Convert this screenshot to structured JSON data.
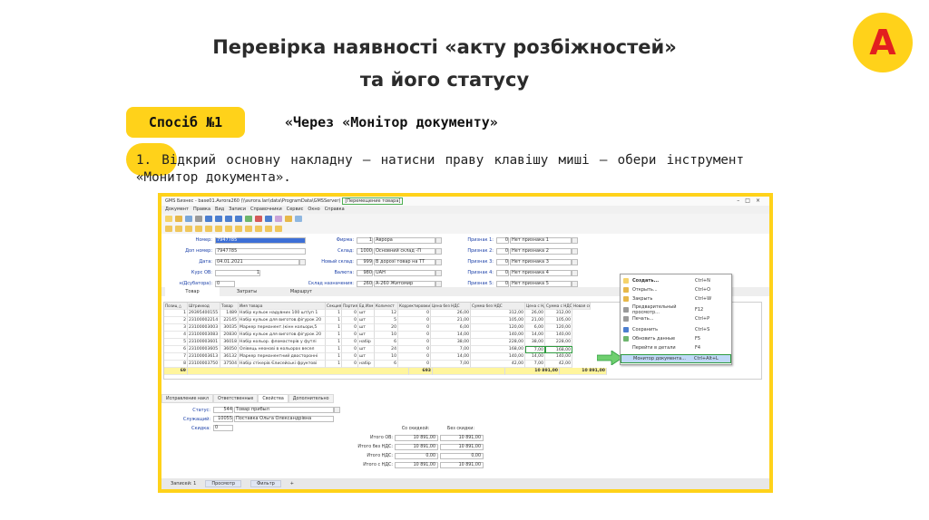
{
  "slide": {
    "title_line1": "Перевірка наявності «акту розбіжностей»",
    "title_line2": "та його статусу",
    "logo_letter": "А",
    "method_label": "Спосіб №1",
    "method_text": "«Через «Монітор документу»",
    "step_text": "1.  Відкрий основну накладну – натисни праву клавішу миші – обери інструмент «Монитор документа».",
    "colors": {
      "accent_yellow": "#ffd21a",
      "logo_red": "#e21f1f",
      "highlight_green": "#2e9b3f",
      "selection_blue": "#3d6fd6"
    }
  },
  "app": {
    "title": "GMS Бизнес - base01.Avrora260 (\\\\avrora.lan\\data\\ProgramData\\GMSServer)",
    "doc_title": "[Перемещение товара]",
    "window_controls": [
      "–",
      "□",
      "×"
    ],
    "menu": [
      "Документ",
      "Правка",
      "Вид",
      "Записи",
      "Справочники",
      "Сервис",
      "Окно",
      "Справка"
    ],
    "form": {
      "nomer_label": "Номер:",
      "nomer_value": "7947785",
      "dop_nomer_label": "Доп номер:",
      "dop_nomer_value": "7947785",
      "data_label": "Дата:",
      "data_value": "04.01.2021",
      "kurs_label": "Курс ОВ:",
      "kurs_value": "1",
      "sch_label": "н/Дсубатора):",
      "sch_value": "0",
      "firma_label": "Фирма:",
      "firma_num": "1",
      "firma_value": "Аврора",
      "sklad_label": "Склад:",
      "sklad_num": "1000",
      "sklad_value": "Основний склад -П",
      "novy_sklad_label": "Новый склад:",
      "novy_sklad_num": "999",
      "novy_sklad_value": "В дорозі товар на ТТ",
      "valuta_label": "Валюта:",
      "valuta_num": "980",
      "valuta_value": "UAH",
      "sklad_nazn_label": "Склад назначения:",
      "sklad_nazn_num": "260",
      "sklad_nazn_value": "А-260 Житомир",
      "priznaks": [
        {
          "label": "Признак 1:",
          "num": "0",
          "value": "Нет признака 1"
        },
        {
          "label": "Признак 2:",
          "num": "0",
          "value": "Нет признака 2"
        },
        {
          "label": "Признак 3:",
          "num": "0",
          "value": "Нет признака 3"
        },
        {
          "label": "Признак 4:",
          "num": "0",
          "value": "Нет признака 4"
        },
        {
          "label": "Признак 5:",
          "num": "0",
          "value": "Нет признака 5"
        }
      ]
    },
    "tabs": [
      "Товар",
      "Затраты",
      "Маршрут"
    ],
    "grid": {
      "columns": [
        "Позиц △",
        "Штрихкод",
        "Товар",
        "Имя товара",
        "Секция",
        "Партия",
        "Ед Изм",
        "Количест",
        "Корректировки кол-ва",
        "Цена без НДС",
        "Сумма без НДС",
        "Цена с НДС",
        "Сумма с НДС",
        "Новая секция"
      ],
      "rows": [
        [
          "1",
          "29395400155",
          "1489",
          "Набір кульок надувних 100 шт/уп 1",
          "1",
          "0",
          "шт",
          "12",
          "0",
          "26,00",
          "312,00",
          "26,00",
          "312,00"
        ],
        [
          "2",
          "23100002214",
          "22145",
          "Набір кульок для виготов.фігурок 20",
          "1",
          "0",
          "шт",
          "5",
          "0",
          "21,00",
          "105,00",
          "21,00",
          "105,00"
        ],
        [
          "3",
          "23100003003",
          "30035",
          "Маркер перманент.(кінн кольори,5",
          "1",
          "0",
          "шт",
          "20",
          "0",
          "6,00",
          "120,00",
          "6,00",
          "120,00"
        ],
        [
          "4",
          "23100003083",
          "20830",
          "Набір кульок для виготов.фігурок 20",
          "1",
          "0",
          "шт",
          "10",
          "0",
          "14,00",
          "140,00",
          "14,00",
          "140,00"
        ],
        [
          "5",
          "23100003601",
          "36018",
          "Набір кольор. фломастерів у футлі",
          "1",
          "0",
          "набір",
          "6",
          "0",
          "38,00",
          "228,00",
          "38,00",
          "228,00"
        ],
        [
          "6",
          "23100003605",
          "36050",
          "Олівець неонові в кольорах весел",
          "1",
          "0",
          "шт",
          "24",
          "0",
          "7,00",
          "168,00",
          "7,00",
          "168,00"
        ],
        [
          "7",
          "23100003613",
          "36132",
          "Маркер перманентний двосторонні",
          "1",
          "0",
          "шт",
          "10",
          "0",
          "14,00",
          "140,00",
          "14,00",
          "140,00"
        ],
        [
          "8",
          "23100003750",
          "37504",
          "Набір стікерів Єлисейськi фруктові",
          "1",
          "0",
          "набір",
          "6",
          "0",
          "7,00",
          "42,00",
          "7,00",
          "42,00"
        ]
      ],
      "total": {
        "positions": "69",
        "qty": "693",
        "sum_no_vat": "10 891,00",
        "sum_vat": "10 891,00"
      }
    },
    "context_menu": [
      {
        "label": "Создать...",
        "shortcut": "Ctrl+N",
        "bold": true
      },
      {
        "label": "Открыть...",
        "shortcut": "Ctrl+O"
      },
      {
        "label": "Закрыть",
        "shortcut": "Ctrl+W"
      },
      {
        "label": "Предварительный просмотр...",
        "shortcut": "F12"
      },
      {
        "label": "Печать...",
        "shortcut": "Ctrl+P"
      },
      {
        "label": "Сохранить",
        "shortcut": "Ctrl+S"
      },
      {
        "label": "Обновить данные",
        "shortcut": "F5"
      },
      {
        "label": "Перейти в детали",
        "shortcut": "F4"
      },
      {
        "label": "Монитор документа...",
        "shortcut": "Ctrl+Alt+L",
        "highlighted": true
      }
    ],
    "subtabs": [
      "Исправление накл",
      "Ответственные",
      "Свойства",
      "Дополнительно"
    ],
    "props": {
      "status_label": "Статус:",
      "status_num": "544",
      "status_value": "Товар прибыл",
      "sluzh_label": "Служащий:",
      "sluzh_num": "10055",
      "sluzh_value": "Поставка Ольга Олександрівна",
      "skidka_label": "Скидка:",
      "skidka_value": "0"
    },
    "totals": {
      "col1": "Со скидкой:",
      "col2": "Без скидки:",
      "rows": [
        {
          "label": "Итого ОВ:",
          "v1": "10 891,00",
          "v2": "10 891,00"
        },
        {
          "label": "Итого без НДС:",
          "v1": "10 891,00",
          "v2": "10 891,00"
        },
        {
          "label": "Итого НДС:",
          "v1": "0,00",
          "v2": "0,00"
        },
        {
          "label": "Итого с НДС:",
          "v1": "10 891,00",
          "v2": "10 891,00"
        }
      ]
    },
    "statusbar": {
      "records": "Записей: 1",
      "view": "Просмотр",
      "filter": "Фильтр",
      "add": "+"
    }
  }
}
